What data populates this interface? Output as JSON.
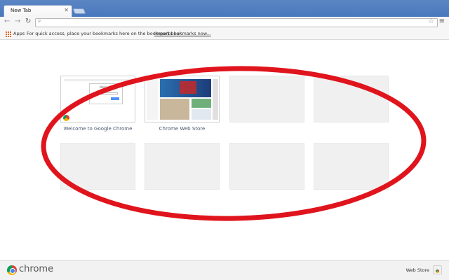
{
  "tab": {
    "title": "New Tab",
    "close_glyph": "✕"
  },
  "toolbar": {
    "back_glyph": "←",
    "forward_glyph": "→",
    "reload_glyph": "↻",
    "omnibox_value": "",
    "search_glyph": "⌕",
    "star_glyph": "☆",
    "menu_glyph": "≡"
  },
  "bookmarks_bar": {
    "apps_label": "Apps",
    "hint_text": "For quick access, place your bookmarks here on the bookmarks bar.",
    "import_link": "Import bookmarks now..."
  },
  "most_visited": [
    {
      "caption": "Welcome to Google Chrome",
      "thumb": "welcome"
    },
    {
      "caption": "Chrome Web Store",
      "thumb": "store"
    },
    {
      "caption": "",
      "thumb": "empty"
    },
    {
      "caption": "",
      "thumb": "empty"
    },
    {
      "caption": "",
      "thumb": "empty"
    },
    {
      "caption": "",
      "thumb": "empty"
    },
    {
      "caption": "",
      "thumb": "empty"
    },
    {
      "caption": "",
      "thumb": "empty"
    }
  ],
  "thumb_welcome_heading": "Welcome",
  "footer": {
    "brand": "chrome",
    "webstore_label": "Web Store"
  },
  "colors": {
    "annotation_red": "#e0141c",
    "titlebar_blue": "#4a78bd",
    "caption_text": "#4a5a6e"
  }
}
